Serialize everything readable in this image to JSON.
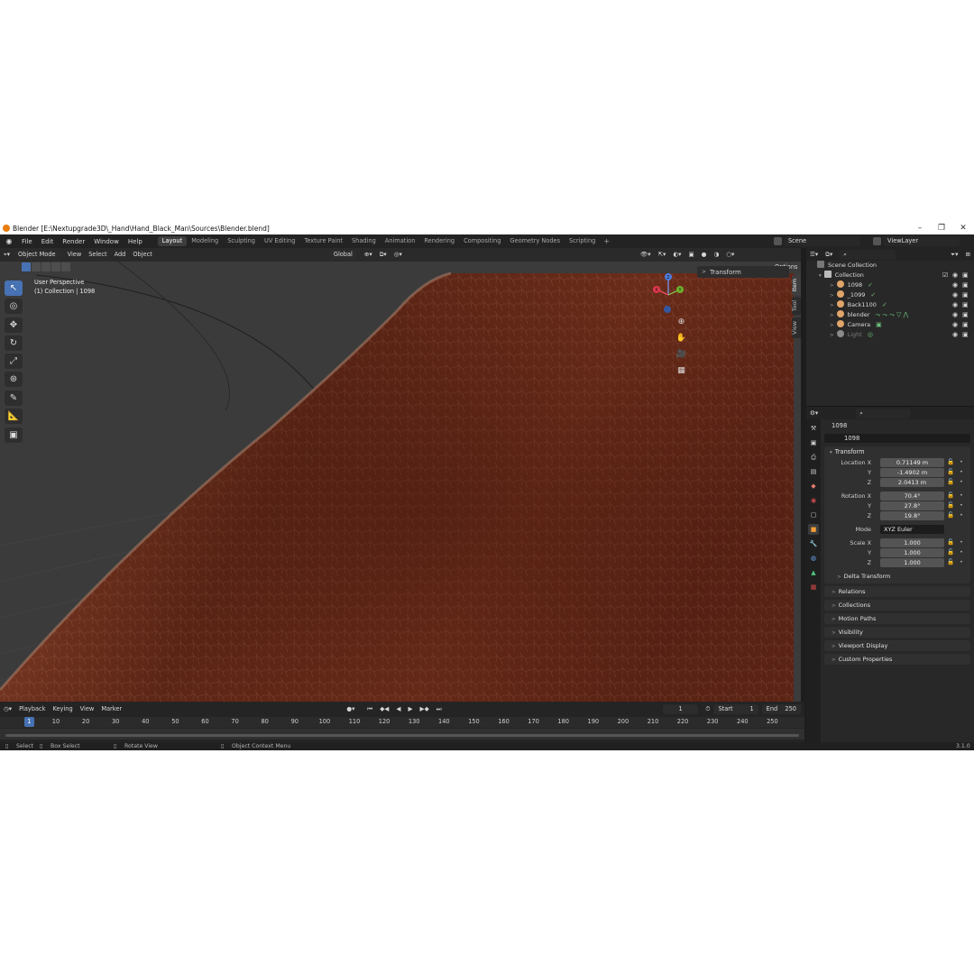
{
  "window": {
    "title": "Blender [E:\\Nextupgrade3D\\_Hand\\Hand_Black_Man\\Sources\\Blender.blend]",
    "min_icon": "–",
    "max_icon": "❐",
    "close_icon": "✕"
  },
  "menubar": {
    "menus": [
      "File",
      "Edit",
      "Render",
      "Window",
      "Help"
    ],
    "workspaces": [
      "Layout",
      "Modeling",
      "Sculpting",
      "UV Editing",
      "Texture Paint",
      "Shading",
      "Animation",
      "Rendering",
      "Compositing",
      "Geometry Nodes",
      "Scripting"
    ],
    "active_workspace": "Layout",
    "scene": "Scene",
    "view_layer": "ViewLayer"
  },
  "viewport": {
    "mode": "Object Mode",
    "menus": [
      "View",
      "Select",
      "Add",
      "Object"
    ],
    "orientation": "Global",
    "options": "Options",
    "overlay_line1": "User Perspective",
    "overlay_line2": "(1) Collection | 1098",
    "npanel_transform": "Transform",
    "side_tabs": [
      "Item",
      "Tool",
      "View"
    ],
    "gizmo": {
      "x": "X",
      "y": "Y",
      "z": "Z"
    },
    "skin_color": "#6b2a1a"
  },
  "timeline": {
    "menus": [
      "Playback",
      "Keying",
      "View",
      "Marker"
    ],
    "current_frame": "1",
    "start_label": "Start",
    "start": "1",
    "end_label": "End",
    "end": "250",
    "ticks": [
      "1",
      "10",
      "20",
      "30",
      "40",
      "50",
      "60",
      "70",
      "80",
      "90",
      "100",
      "110",
      "120",
      "130",
      "140",
      "150",
      "160",
      "170",
      "180",
      "190",
      "200",
      "210",
      "220",
      "230",
      "240",
      "250"
    ]
  },
  "statusbar": {
    "select": "Select",
    "box_select": "Box Select",
    "rotate_view": "Rotate View",
    "context_menu": "Object Context Menu",
    "version": "3.1.0"
  },
  "outliner": {
    "scene_collection": "Scene Collection",
    "collection": "Collection",
    "items": [
      {
        "name": "1098",
        "color": "#e0a56a"
      },
      {
        "name": "_1099",
        "color": "#e0a56a"
      },
      {
        "name": "Back1100",
        "color": "#e0a56a"
      },
      {
        "name": "blender",
        "color": "#e0a56a"
      },
      {
        "name": "Camera",
        "color": "#e0a56a"
      },
      {
        "name": "Light",
        "color": "#8a8a8a"
      }
    ]
  },
  "properties": {
    "object_name": "1098",
    "datablock_name": "1098",
    "transform_title": "Transform",
    "location": {
      "label": "Location X",
      "x": "0.71149 m",
      "y": "-1.4902 m",
      "z": "2.0413 m"
    },
    "rotation": {
      "label": "Rotation X",
      "x": "70.4°",
      "y": "27.8°",
      "z": "19.8°"
    },
    "mode_label": "Mode",
    "mode": "XYZ Euler",
    "scale": {
      "label": "Scale X",
      "x": "1.000",
      "y": "1.000",
      "z": "1.000"
    },
    "axis_y": "Y",
    "axis_z": "Z",
    "delta_transform": "Delta Transform",
    "sections": [
      "Relations",
      "Collections",
      "Motion Paths",
      "Visibility",
      "Viewport Display",
      "Custom Properties"
    ]
  }
}
